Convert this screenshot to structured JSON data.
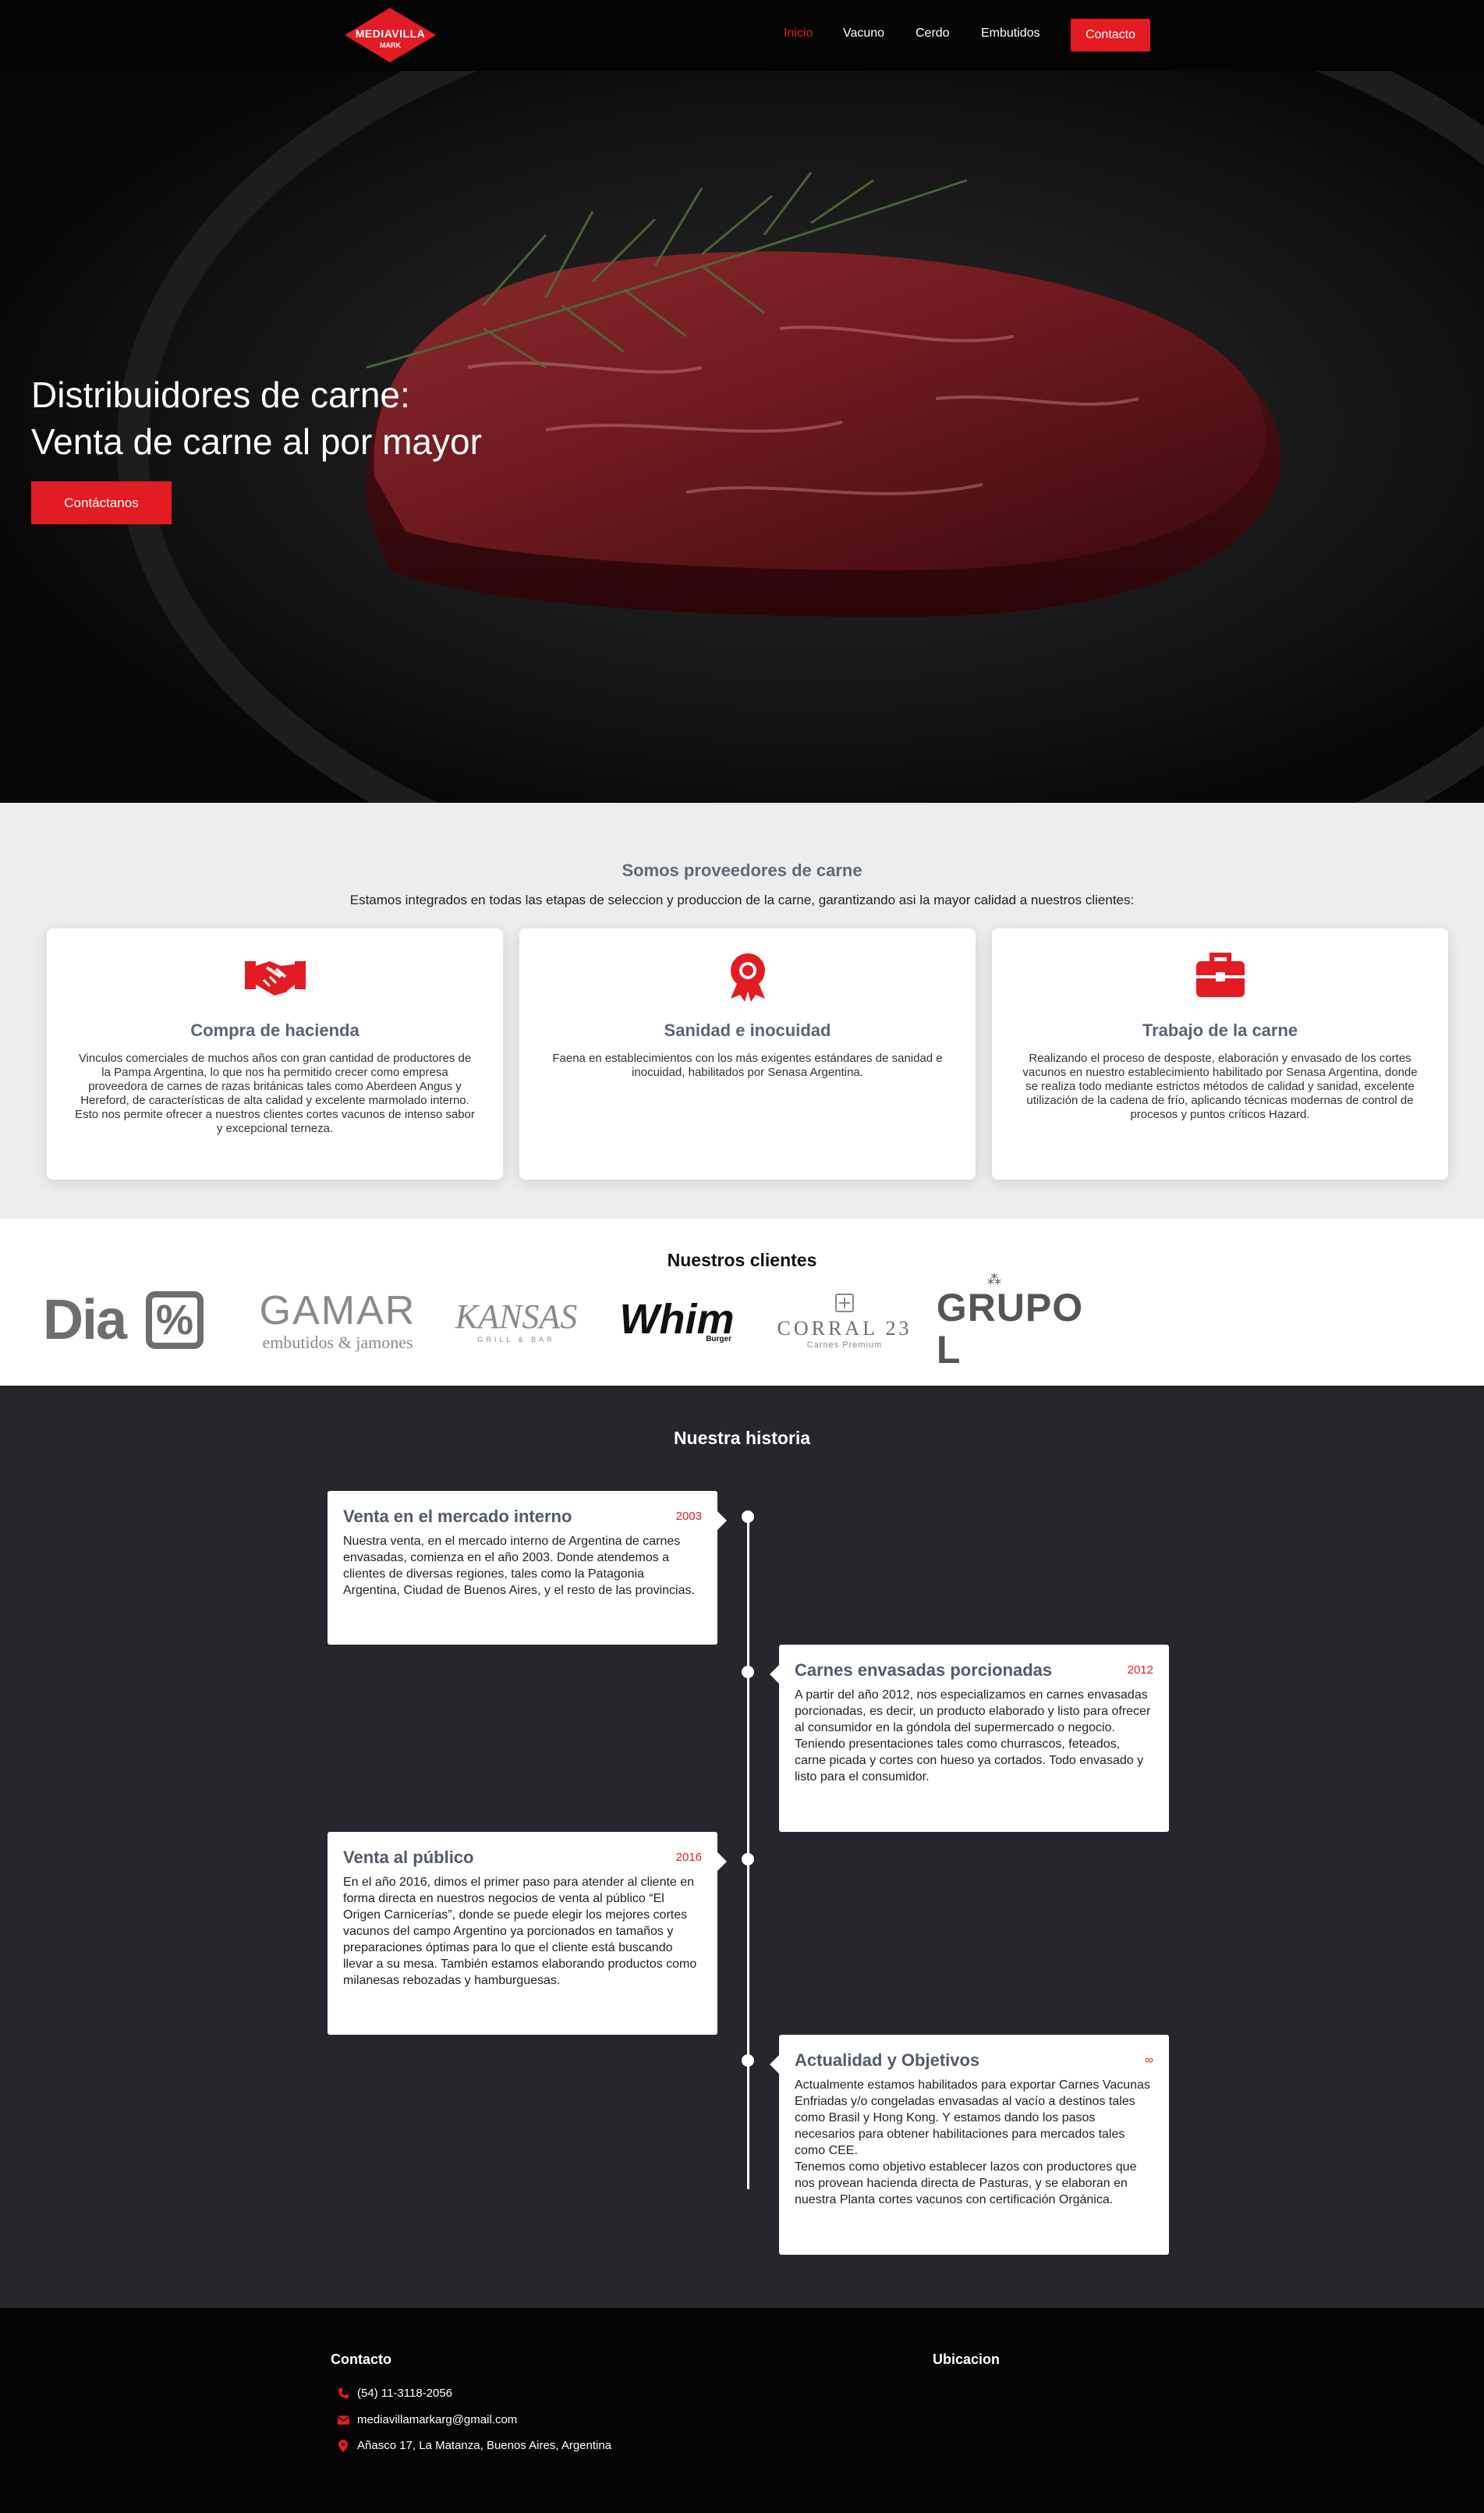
{
  "nav": {
    "logo_brand": "MEDIAVILLA",
    "logo_sub": "MARK",
    "links": [
      "Inicio",
      "Vacuno",
      "Cerdo",
      "Embutidos"
    ],
    "cta": "Contacto",
    "active_color": "#e31b23"
  },
  "hero": {
    "title_line1": "Distribuidores de carne:",
    "title_line2": "Venta de carne al por mayor",
    "button": "Contáctanos"
  },
  "proveedores": {
    "title": "Somos proveedores de carne",
    "subtitle": "Estamos integrados en todas las etapas de seleccion y produccion de la carne, garantizando asi la mayor calidad a nuestros clientes:",
    "cards": [
      {
        "icon": "handshake-icon",
        "title": "Compra de hacienda",
        "text": "Vinculos comerciales de muchos años con gran cantidad de productores de la Pampa Argentina, lo que nos ha permitido crecer como empresa proveedora de carnes de razas británicas tales como Aberdeen Angus y Hereford, de características de alta calidad y excelente marmolado interno. Esto nos permite ofrecer a nuestros clientes cortes vacunos de intenso sabor y excepcional terneza."
      },
      {
        "icon": "award-ribbon-icon",
        "title": "Sanidad e inocuidad",
        "text": "Faena en establecimientos con los más exigentes estándares de sanidad e inocuidad, habilitados por Senasa Argentina."
      },
      {
        "icon": "briefcase-icon",
        "title": "Trabajo de la carne",
        "text": "Realizando el proceso de desposte, elaboración y envasado de los cortes vacunos en nuestro establecimiento habilitado por Senasa Argentina, donde se realiza todo mediante estrictos métodos de calidad y sanidad, excelente utilización de la cadena de frío, aplicando técnicas modernas de control de procesos y puntos críticos Hazard."
      }
    ]
  },
  "clientes": {
    "title": "Nuestros clientes",
    "logos": {
      "dia": "Dia",
      "dia_symbol": "%",
      "gamar": "GAMAR",
      "gamar_sub": "embutidos & jamones",
      "kansas": "KANSAS",
      "kansas_sub": "GRILL & BAR",
      "whim": "Whim",
      "whim_sub": "Burger",
      "corral": "CORRAL 23",
      "corral_sub": "Carnes Premium",
      "grupo": "GRUPO L"
    }
  },
  "historia": {
    "title": "Nuestra historia",
    "items": [
      {
        "title": "Venta en el mercado interno",
        "year": "2003",
        "text": "Nuestra venta, en el mercado interno de Argentina de carnes envasadas, comienza en el año 2003. Donde atendemos a clientes de diversas regiones, tales como la Patagonia Argentina, Ciudad de Buenos Aires, y el resto de las provincias."
      },
      {
        "title": "Carnes envasadas porcionadas",
        "year": "2012",
        "text": "A partir del año 2012, nos especializamos en carnes envasadas porcionadas, es decir, un producto elaborado y listo para ofrecer al consumidor en la góndola del supermercado o negocio. Teniendo presentaciones tales como churrascos, feteados, carne picada y cortes con hueso ya cortados. Todo envasado y listo para el consumidor."
      },
      {
        "title": "Venta al público",
        "year": "2016",
        "text": "En el año 2016, dimos el primer paso para atender al cliente en forma directa en nuestros negocios de venta al público “El Origen Carnicerías”, donde se puede elegir los mejores cortes vacunos del campo Argentino ya porcionados en tamaños y preparaciones óptimas para lo que el cliente está buscando llevar a su mesa. También estamos elaborando productos como milanesas rebozadas y hamburguesas."
      },
      {
        "title": "Actualidad y Objetivos",
        "year": "∞",
        "text": "Actualmente estamos habilitados para exportar Carnes Vacunas Enfriadas y/o congeladas envasadas al vacío a destinos tales como Brasil y Hong Kong. Y estamos dando los pasos necesarios para obtener habilitaciones para mercados tales como CEE.\nTenemos como objetivo establecer lazos con productores que nos provean hacienda directa de Pasturas, y se elaboran en nuestra Planta cortes vacunos con certificación Orgánica."
      }
    ]
  },
  "footer": {
    "contacto_title": "Contacto",
    "ubicacion_title": "Ubicacion",
    "phone": "(54) 11-3118-2056",
    "email": "mediavillamarkarg@gmail.com",
    "address": "Añasco 17, La Matanza, Buenos Aires, Argentina"
  },
  "colors": {
    "accent": "#e31b23",
    "dark": "#25272c",
    "light_bg": "#ebedef"
  }
}
